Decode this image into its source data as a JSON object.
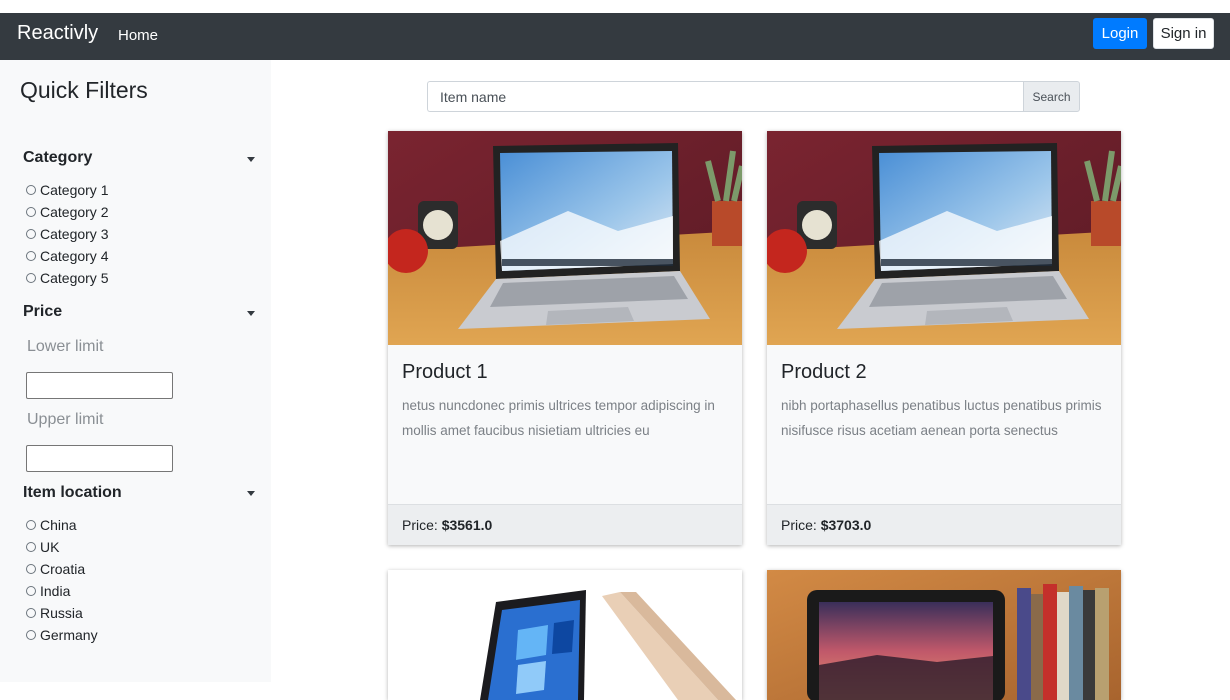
{
  "navbar": {
    "brand": "Reactivly",
    "home": "Home",
    "login": "Login",
    "signin": "Sign in"
  },
  "sidebar": {
    "title": "Quick Filters",
    "category": {
      "heading": "Category",
      "options": [
        "Category 1",
        "Category 2",
        "Category 3",
        "Category 4",
        "Category 5"
      ]
    },
    "price": {
      "heading": "Price",
      "lower_label": "Lower limit",
      "upper_label": "Upper limit",
      "lower_value": "",
      "upper_value": ""
    },
    "location": {
      "heading": "Item location",
      "options": [
        "China",
        "UK",
        "Croatia",
        "India",
        "Russia",
        "Germany"
      ]
    }
  },
  "search": {
    "placeholder": "Item name",
    "value": "",
    "button": "Search"
  },
  "products": [
    {
      "title": "Product 1",
      "description": "netus nuncdonec primis ultrices tempor adipiscing in mollis amet faucibus nisietiam ultricies eu",
      "price_label": "Price:",
      "price": "$3561.0"
    },
    {
      "title": "Product 2",
      "description": "nibh portaphasellus penatibus luctus penatibus primis nisifusce risus acetiam aenean porta senectus",
      "price_label": "Price:",
      "price": "$3703.0"
    },
    {
      "title": "",
      "description": "",
      "price_label": "",
      "price": ""
    },
    {
      "title": "",
      "description": "",
      "price_label": "",
      "price": ""
    }
  ],
  "colors": {
    "navbar": "#343a40",
    "primary": "#007bff",
    "sidebar": "#f8f9fa",
    "card_body": "#f8f9fa",
    "card_footer": "#eceef0"
  },
  "icons": {
    "section_toggle": "caret-down-icon",
    "radio": "radio-circle-icon"
  }
}
